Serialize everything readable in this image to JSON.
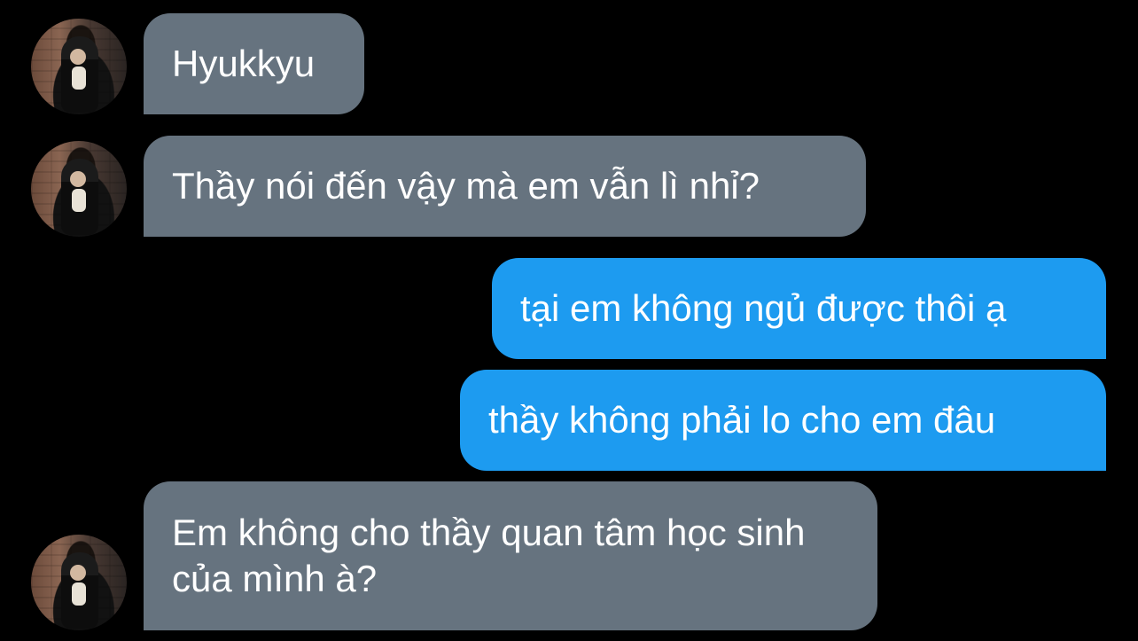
{
  "conversation": {
    "messages": [
      {
        "sender": "them",
        "text": "Hyukkyu"
      },
      {
        "sender": "them",
        "text": "Thầy nói đến vậy mà em vẫn lì nhỉ?"
      },
      {
        "sender": "me",
        "text": "tại em không ngủ được thôi ạ"
      },
      {
        "sender": "me",
        "text": "thầy không phải lo cho em đâu"
      },
      {
        "sender": "them",
        "text": "Em không cho thầy quan tâm học sinh của mình à?"
      }
    ]
  },
  "colors": {
    "background": "#000000",
    "incoming_bubble": "#66737f",
    "outgoing_bubble": "#1d9bf0",
    "text": "#ffffff"
  }
}
